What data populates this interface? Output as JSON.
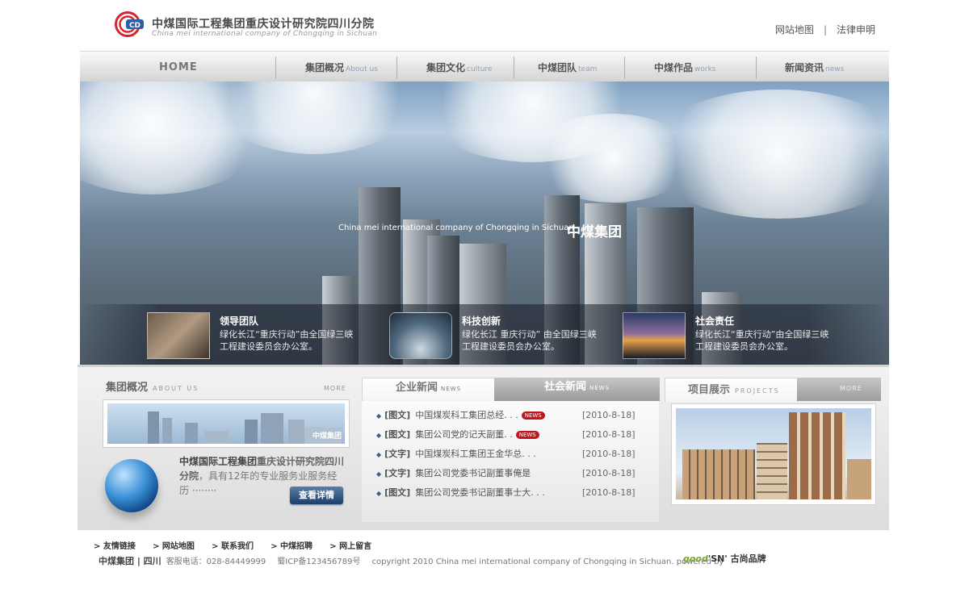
{
  "header": {
    "logo_cn": "中煤国际工程集团重庆设计研究院四川分院",
    "logo_en": "China mei international company of Chongqing in Sichuan",
    "links": [
      "网站地图",
      "法律申明"
    ],
    "sep": "|"
  },
  "nav": {
    "home": "HOME",
    "items": [
      {
        "cn": "集团概况",
        "en": "About us"
      },
      {
        "cn": "集团文化",
        "en": "culture"
      },
      {
        "cn": "中煤团队",
        "en": "team"
      },
      {
        "cn": "中煤作品",
        "en": "works"
      },
      {
        "cn": "新闻资讯",
        "en": "news"
      }
    ]
  },
  "banner": {
    "caption_en": "China mei international company of Chongqing in Sichuan",
    "caption_cn": "中煤集团",
    "features": [
      {
        "title": "领导团队",
        "desc": "绿化长江“重庆行动”由全国绿三峡工程建设委员会办公室。"
      },
      {
        "title": "科技创新",
        "desc": "绿化长江 重庆行动” 由全国绿三峡工程建设委员会办公室。"
      },
      {
        "title": "社会责任",
        "desc": "绿化长江“重庆行动”由全国绿三峡工程建设委员会办公室。"
      }
    ]
  },
  "about": {
    "title": "集团概况",
    "title_en": "ABOUT US",
    "more": "MORE",
    "img_label": "中煤集团",
    "heading_bold": "中煤国际工程集团",
    "heading_rest": "重庆设计研究院四川分院",
    "desc": "，具有12年的专业服务业服务经历 ········",
    "button": "查看详情"
  },
  "news": {
    "tab_active": "企业新闻",
    "tab_active_en": "NEWS",
    "tab_inactive": "社会新闻",
    "tab_inactive_en": "NEWS",
    "items": [
      {
        "tag": "[图文]",
        "text": "中国煤炭科工集团总经. . .",
        "badge": "NEWS",
        "date": "[2010-8-18]"
      },
      {
        "tag": "[图文]",
        "text": "集团公司党的记天副董. .",
        "badge": "NEWS",
        "date": "[2010-8-18]"
      },
      {
        "tag": "[文字]",
        "text": "中国煤炭科工集团王金华总. . .",
        "badge": "",
        "date": "[2010-8-18]"
      },
      {
        "tag": "[文字]",
        "text": "集团公司党委书记副董事俺是",
        "badge": "",
        "date": "[2010-8-18]"
      },
      {
        "tag": "[图文]",
        "text": "集团公司党委书记副董事士大. . .",
        "badge": "",
        "date": "[2010-8-18]"
      }
    ]
  },
  "projects": {
    "title": "项目展示",
    "title_en": "PROJECTS",
    "more": "MORE"
  },
  "footer": {
    "links": [
      "> 友情链接",
      "> 网站地图",
      "> 联系我们",
      "> 中煤招聘",
      "> 网上留言"
    ],
    "brand": "中煤集团 | 四川",
    "phone": "客服电话：028-84449999",
    "icp": "蜀ICP备123456789号",
    "copyright": "copyright 2010 China mei international company of Chongqing in Sichuan. powered by",
    "powered_a": "good",
    "powered_b": "'SN' 古尚品牌"
  },
  "colors": {
    "logo_red": "#d4262f",
    "logo_blue": "#2d5ea8",
    "badge_red": "#c0151d",
    "button_blue": "#1c3f6b"
  }
}
